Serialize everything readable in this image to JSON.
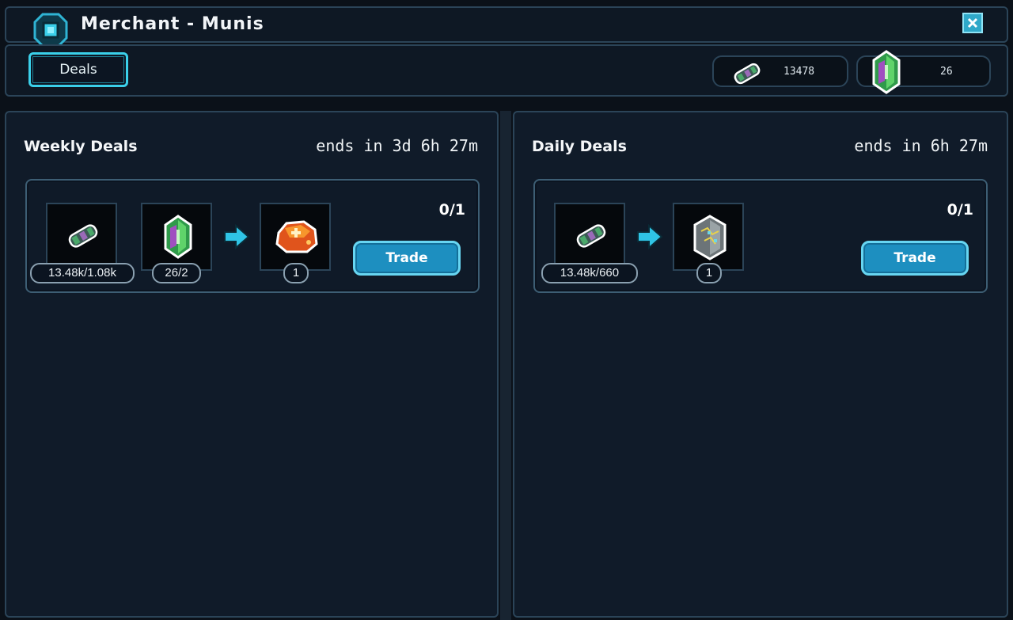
{
  "window": {
    "title": "Merchant - Munis"
  },
  "tabs": [
    {
      "label": "Deals",
      "active": true
    }
  ],
  "currencies": [
    {
      "icon": "bandage-roll-icon",
      "amount": "13478"
    },
    {
      "icon": "green-crystal-icon",
      "amount": "26"
    }
  ],
  "weekly": {
    "title": "Weekly Deals",
    "timer": "ends in 3d 6h 27m",
    "deal": {
      "limit": "0/1",
      "costs": [
        {
          "icon": "bandage-roll-icon",
          "qty": "13.48k/1.08k"
        },
        {
          "icon": "green-crystal-icon",
          "qty": "26/2"
        }
      ],
      "reward": {
        "icon": "orange-ore-icon",
        "qty": "1"
      },
      "trade_label": "Trade"
    }
  },
  "daily": {
    "title": "Daily Deals",
    "timer": "ends in 6h 27m",
    "deal": {
      "limit": "0/1",
      "costs": [
        {
          "icon": "bandage-roll-icon",
          "qty": "13.48k/660"
        }
      ],
      "reward": {
        "icon": "gray-crystal-icon",
        "qty": "1"
      },
      "trade_label": "Trade"
    }
  },
  "colors": {
    "background": "#0b1119",
    "panel": "#101b29",
    "border": "#2b4458",
    "accent": "#3bd0ea",
    "trade_button": "#1d8fc0"
  }
}
